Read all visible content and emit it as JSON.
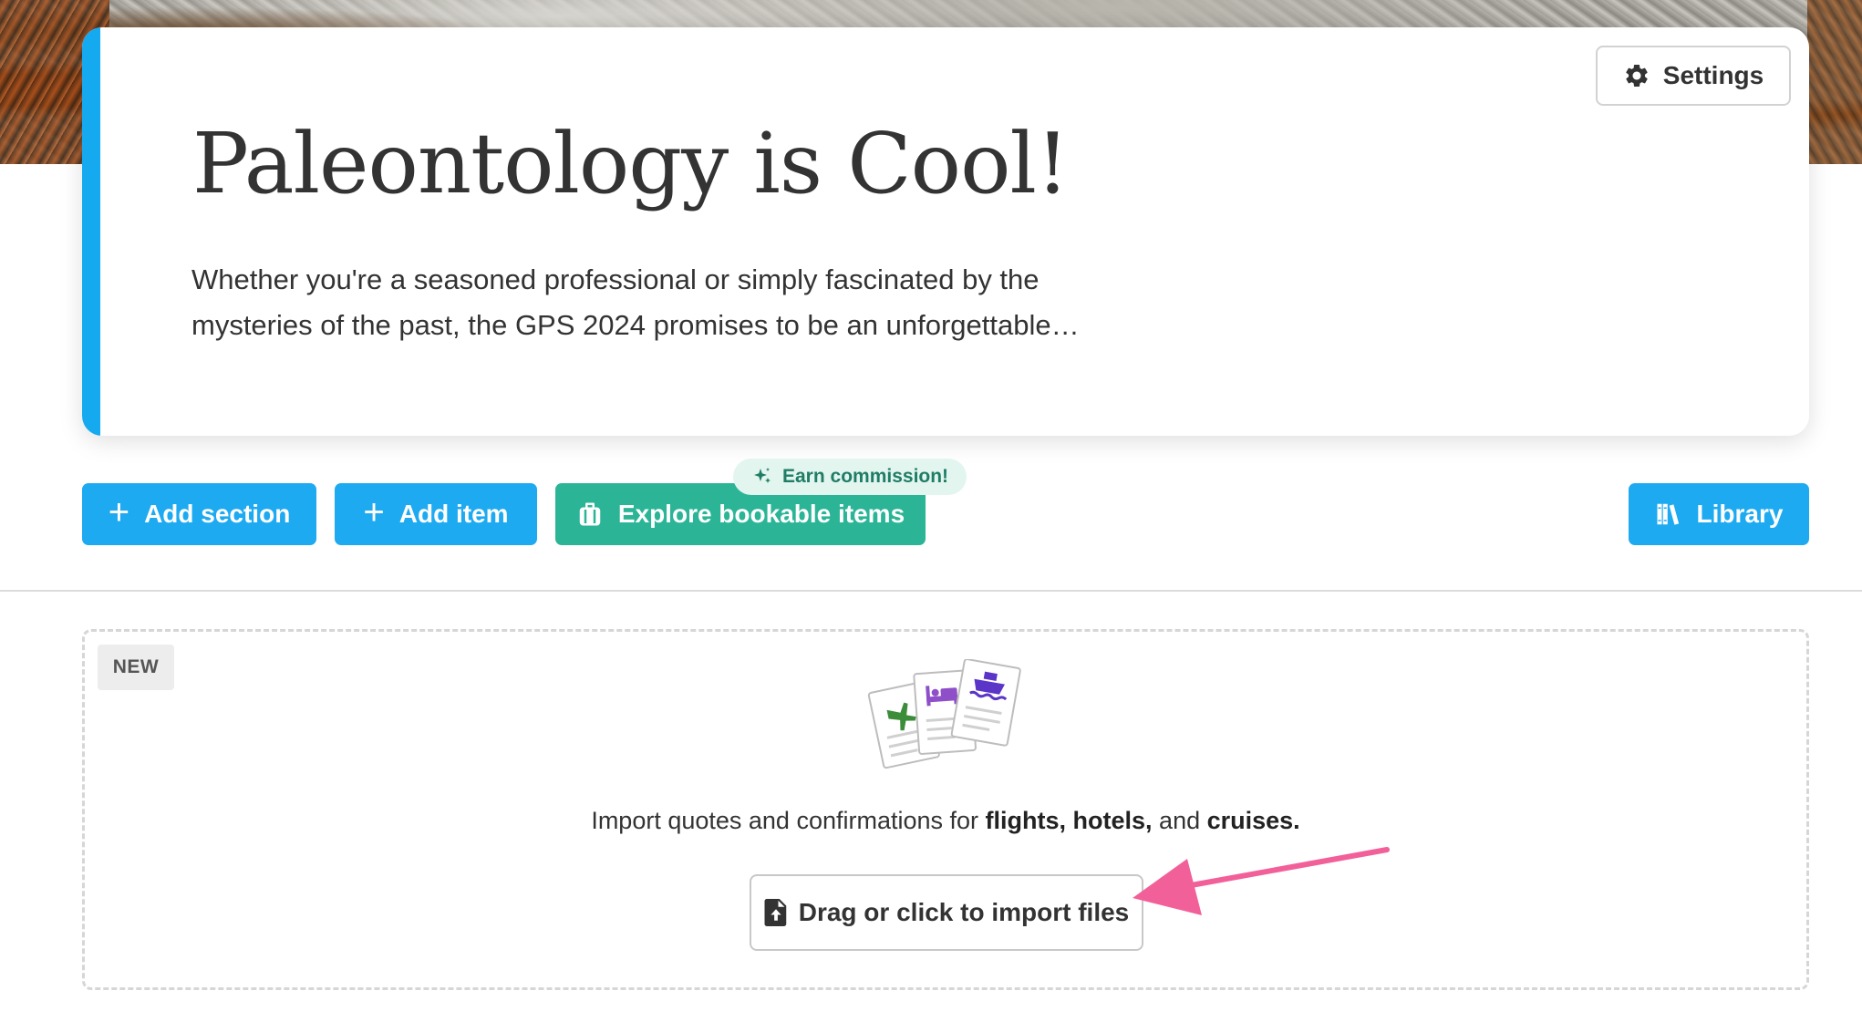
{
  "hero": {
    "title": "Paleontology is Cool!",
    "description_line1": "Whether you're a seasoned professional or simply fascinated by the",
    "description_line2": "mysteries of the past, the GPS 2024 promises to be an unforgettable…",
    "settings_label": "Settings"
  },
  "toolbar": {
    "add_section_label": "Add section",
    "add_item_label": "Add item",
    "explore_label": "Explore bookable items",
    "earn_badge_label": "Earn commission!",
    "library_label": "Library"
  },
  "import": {
    "new_tag": "NEW",
    "text_prefix": "Import quotes and confirmations for ",
    "text_flights": "flights, hotels,",
    "text_and": " and ",
    "text_cruises": "cruises.",
    "button_label": "Drag or click to import files"
  },
  "icons": {
    "settings": "gear-icon",
    "add_section": "plus-icon",
    "add_item": "plus-icon",
    "explore": "suitcase-icon",
    "earn": "sparkle-icon",
    "library": "books-icon",
    "import": "file-upload-icon"
  },
  "colors": {
    "accent_blue": "#1eaaf1",
    "accent_teal": "#2bb596",
    "hero_stripe": "#15a9f0",
    "annotation_arrow": "#f2609a"
  }
}
